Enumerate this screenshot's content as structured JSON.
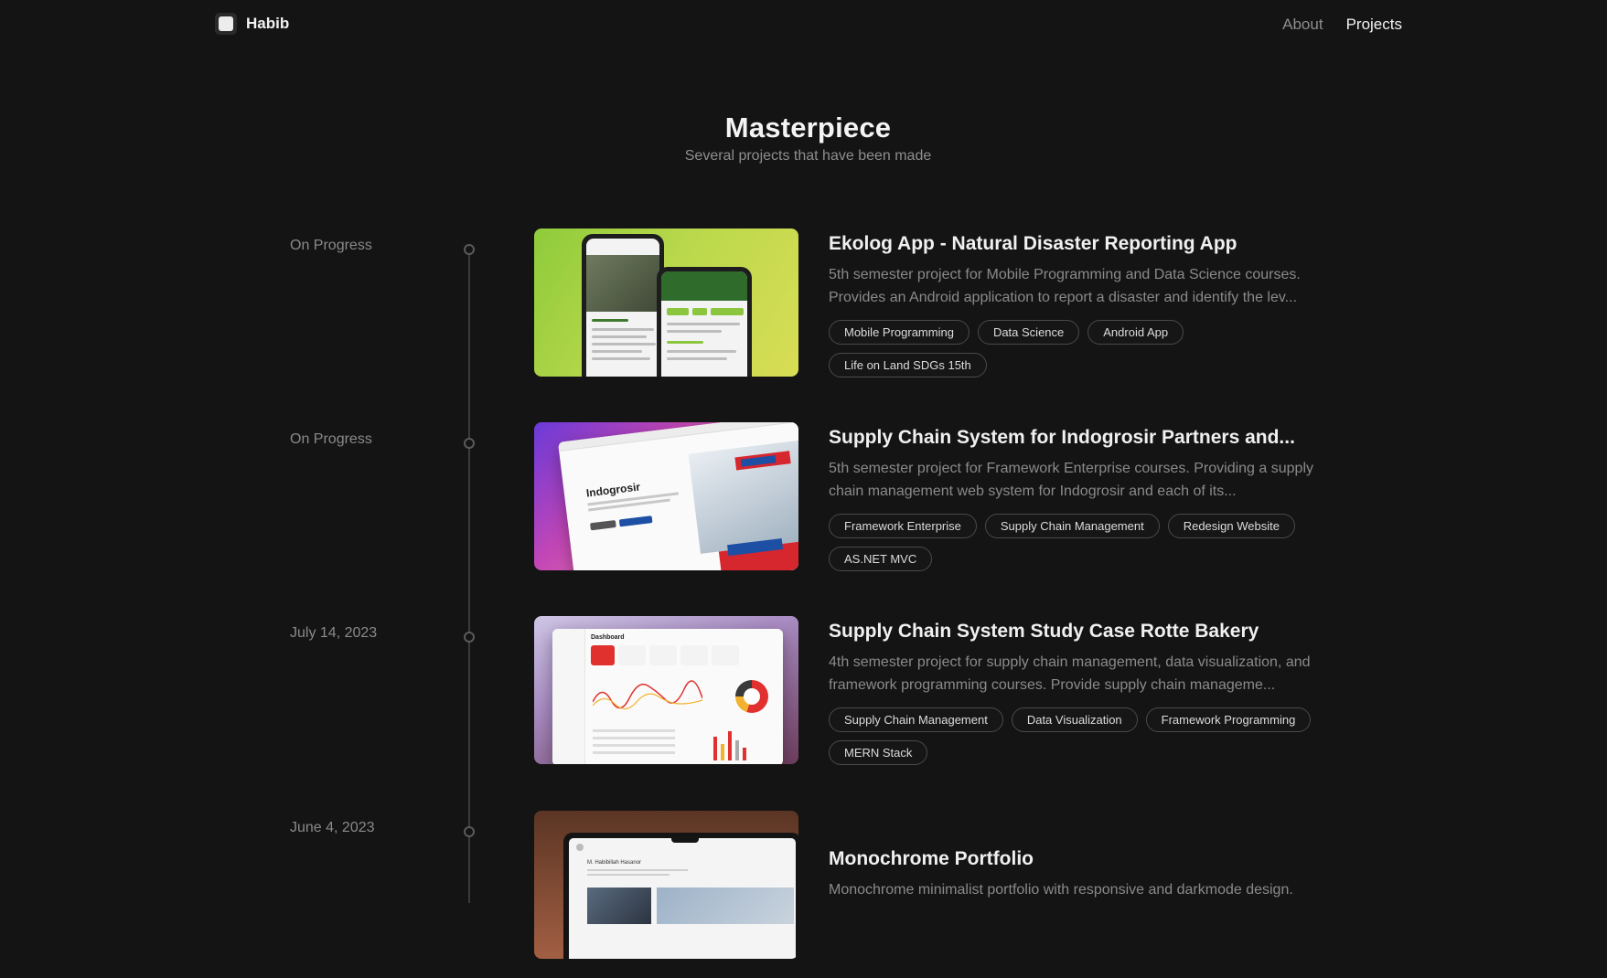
{
  "nav": {
    "brand": "Habib",
    "links": [
      {
        "label": "About",
        "active": false
      },
      {
        "label": "Projects",
        "active": true
      }
    ]
  },
  "hero": {
    "title": "Masterpiece",
    "subtitle": "Several projects that have been made"
  },
  "projects": [
    {
      "date": "On Progress",
      "title": "Ekolog App - Natural Disaster Reporting App",
      "description": "5th semester project for Mobile Programming and Data Science courses. Provides an Android application to report a disaster and identify the lev...",
      "tags": [
        "Mobile Programming",
        "Data Science",
        "Android App",
        "Life on Land SDGs 15th"
      ],
      "thumbnail": "phone-mockup"
    },
    {
      "date": "On Progress",
      "title": "Supply Chain System for Indogrosir Partners and...",
      "description": "5th semester project for Framework Enterprise courses. Providing a supply chain management web system for Indogrosir and each of its...",
      "tags": [
        "Framework Enterprise",
        "Supply Chain Management",
        "Redesign Website",
        "AS.NET MVC"
      ],
      "thumbnail": "browser-mockup",
      "thumbnail_text": "Indogrosir"
    },
    {
      "date": "July 14, 2023",
      "title": "Supply Chain System Study Case Rotte Bakery",
      "description": "4th semester project for supply chain management, data visualization, and framework programming courses. Provide supply chain manageme...",
      "tags": [
        "Supply Chain Management",
        "Data Visualization",
        "Framework Programming",
        "MERN Stack"
      ],
      "thumbnail": "dashboard-mockup",
      "thumbnail_text": "Dashboard"
    },
    {
      "date": "June 4, 2023",
      "title": "Monochrome Portfolio",
      "description": "Monochrome minimalist portfolio with responsive and darkmode design.",
      "tags": [],
      "thumbnail": "laptop-mockup",
      "thumbnail_text": "M. Habibillah Hasanor"
    }
  ]
}
